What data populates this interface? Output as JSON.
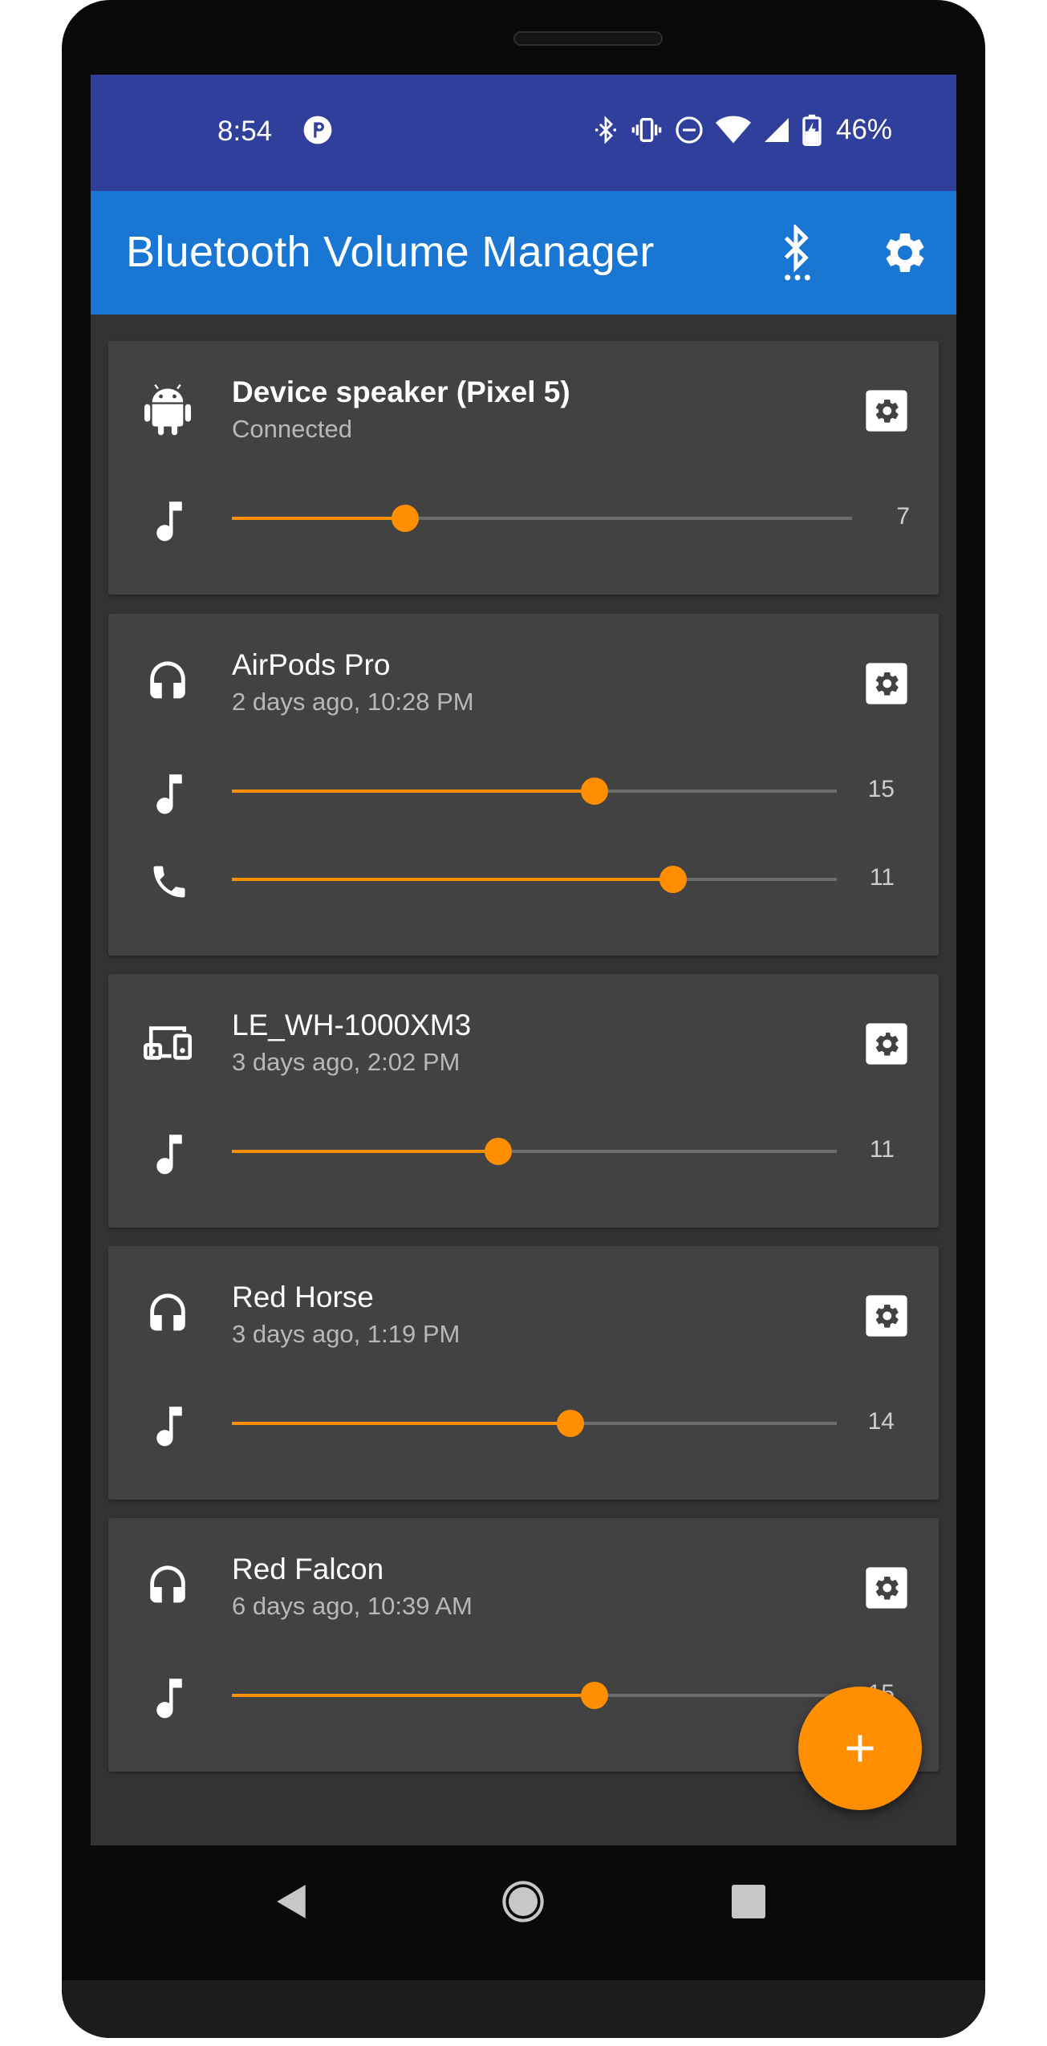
{
  "status_bar": {
    "time": "8:54",
    "battery_percent": "46%",
    "icons": [
      "notification-icon",
      "bluetooth-icon",
      "vibrate-icon",
      "do-not-disturb-icon",
      "wifi-icon",
      "cellular-icon",
      "battery-charging-icon"
    ]
  },
  "app_bar": {
    "title": "Bluetooth Volume Manager",
    "actions": [
      "bluetooth-scan-icon",
      "settings-icon"
    ]
  },
  "devices": [
    {
      "name": "Device speaker (Pixel 5)",
      "status": "Connected",
      "icon": "android-icon",
      "volumes": [
        {
          "type": "music",
          "value": "7",
          "fraction": 0.28
        }
      ]
    },
    {
      "name": "AirPods Pro",
      "status": "2 days ago, 10:28 PM",
      "icon": "headphones-icon",
      "volumes": [
        {
          "type": "music",
          "value": "15",
          "fraction": 0.6
        },
        {
          "type": "call",
          "value": "11",
          "fraction": 0.73
        }
      ]
    },
    {
      "name": "LE_WH-1000XM3",
      "status": "3 days ago, 2:02 PM",
      "icon": "devices-icon",
      "volumes": [
        {
          "type": "music",
          "value": "11",
          "fraction": 0.44
        }
      ]
    },
    {
      "name": "Red Horse",
      "status": "3 days ago, 1:19 PM",
      "icon": "headphones-icon",
      "volumes": [
        {
          "type": "music",
          "value": "14",
          "fraction": 0.56
        }
      ]
    },
    {
      "name": "Red Falcon",
      "status": "6 days ago, 10:39 AM",
      "icon": "headphones-icon",
      "volumes": [
        {
          "type": "music",
          "value": "15",
          "fraction": 0.6
        }
      ]
    }
  ],
  "fab": {
    "icon": "add-icon"
  },
  "nav_bar": {
    "buttons": [
      "back-icon",
      "home-icon",
      "recents-icon"
    ]
  },
  "colors": {
    "status_bar": "#303e9c",
    "app_bar": "#1976d2",
    "accent": "#ff8f00",
    "background": "#333333",
    "card": "#424242"
  }
}
